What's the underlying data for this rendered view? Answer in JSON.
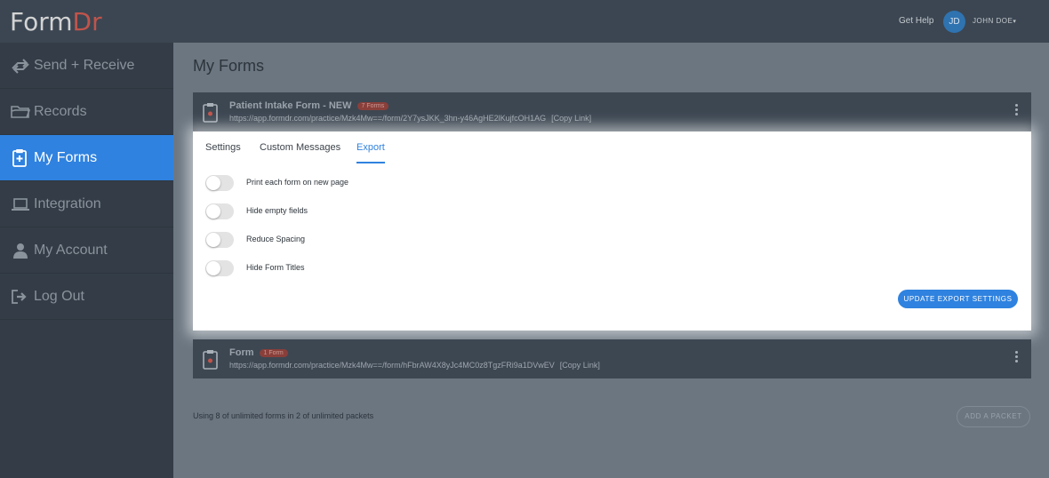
{
  "header": {
    "logo_part1": "Form",
    "logo_part2": "Dr",
    "get_help": "Get Help",
    "avatar_initials": "JD",
    "user_name": "JOHN DOE"
  },
  "sidebar": {
    "items": [
      {
        "label": "Send + Receive",
        "icon": "send-receive-icon"
      },
      {
        "label": "Records",
        "icon": "folder-icon"
      },
      {
        "label": "My Forms",
        "icon": "clipboard-plus-icon",
        "active": true
      },
      {
        "label": "Integration",
        "icon": "laptop-icon"
      },
      {
        "label": "My Account",
        "icon": "user-icon"
      },
      {
        "label": "Log Out",
        "icon": "logout-icon"
      }
    ]
  },
  "main": {
    "title": "My Forms",
    "forms": [
      {
        "name": "Patient Intake Form - NEW",
        "badge": "7 Forms",
        "url": "https://app.formdr.com/practice/Mzk4Mw==/form/2Y7ysJKK_3hn-y46AgHE2lKujfcOH1AG",
        "copy_link": "[Copy Link]"
      },
      {
        "name": "Form",
        "badge": "1 Form",
        "url": "https://app.formdr.com/practice/Mzk4Mw==/form/hFbrAW4X8yJc4MC0z8TgzFRi9a1DVwEV",
        "copy_link": "[Copy Link]"
      }
    ],
    "panel": {
      "tabs": [
        "Settings",
        "Custom Messages",
        "Export"
      ],
      "active_tab": "Export",
      "options": [
        {
          "label": "Print each form on new page",
          "enabled": false
        },
        {
          "label": "Hide empty fields",
          "enabled": false
        },
        {
          "label": "Reduce Spacing",
          "enabled": false
        },
        {
          "label": "Hide Form Titles",
          "enabled": false
        }
      ],
      "update_button": "UPDATE EXPORT SETTINGS"
    },
    "usage_text": "Using 8 of unlimited forms in 2 of unlimited packets",
    "add_packet": "ADD A PACKET"
  },
  "colors": {
    "accent": "#2f82df",
    "logo_accent": "#c0544b",
    "sidebar_bg": "#343d47",
    "main_bg": "#6b7681"
  }
}
